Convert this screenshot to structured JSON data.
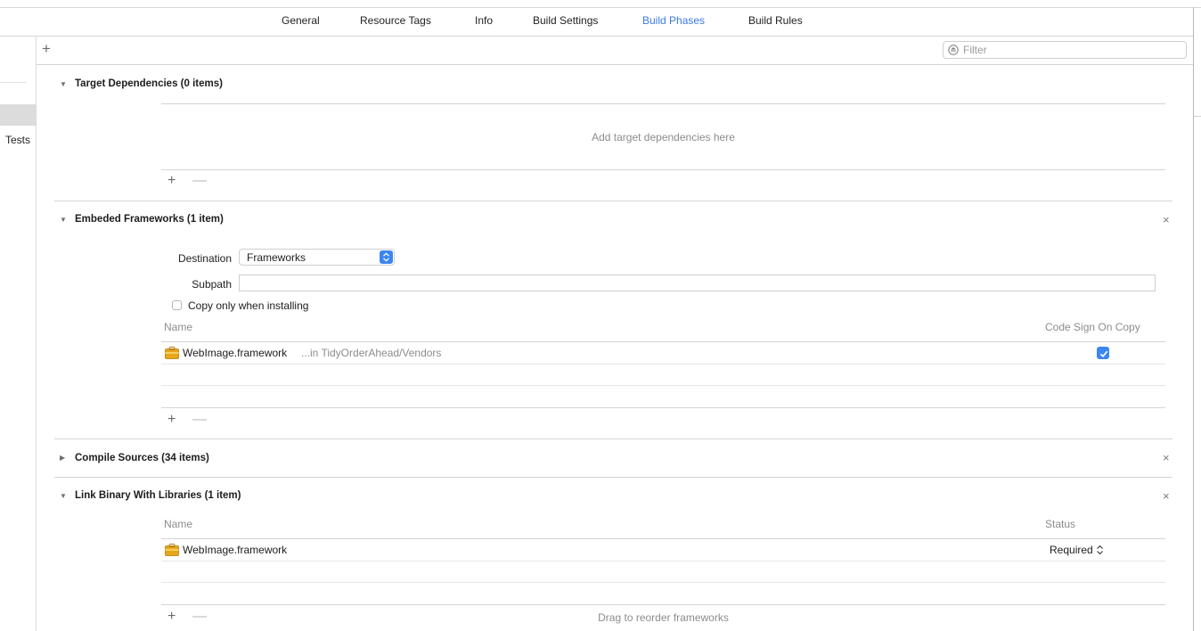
{
  "tabs": [
    {
      "label": "General"
    },
    {
      "label": "Resource Tags"
    },
    {
      "label": "Info"
    },
    {
      "label": "Build Settings"
    },
    {
      "label": "Build Phases",
      "active": true
    },
    {
      "label": "Build Rules"
    }
  ],
  "sidebar": {
    "selected_suffix": "Tests"
  },
  "toolbar": {
    "add_symbol": "+",
    "filter_placeholder": "Filter"
  },
  "sections": {
    "target_dependencies": {
      "title": "Target Dependencies (0 items)",
      "empty_text": "Add target dependencies here"
    },
    "embedded_frameworks": {
      "title": "Embeded Frameworks (1 item)",
      "destination_label": "Destination",
      "destination_value": "Frameworks",
      "subpath_label": "Subpath",
      "subpath_value": "",
      "copy_only_label": "Copy only when installing",
      "copy_only_checked": false,
      "col_name": "Name",
      "col_codesign": "Code Sign On Copy",
      "rows": [
        {
          "name": "WebImage.framework",
          "location": "...in TidyOrderAhead/Vendors",
          "code_sign": true
        }
      ]
    },
    "compile_sources": {
      "title": "Compile Sources (34 items)"
    },
    "link_binary": {
      "title": "Link Binary With Libraries (1 item)",
      "col_name": "Name",
      "col_status": "Status",
      "rows": [
        {
          "name": "WebImage.framework",
          "status": "Required"
        }
      ],
      "footer_hint": "Drag to reorder frameworks"
    }
  },
  "symbols": {
    "plus": "+",
    "minus": "—",
    "close": "×",
    "expanded": "▼",
    "collapsed": "▶",
    "updown": "⌃⌄"
  },
  "colors": {
    "accent": "#3b7ae8",
    "checkbox": "#3b86f0",
    "icon_gold": "#e7a61b"
  }
}
